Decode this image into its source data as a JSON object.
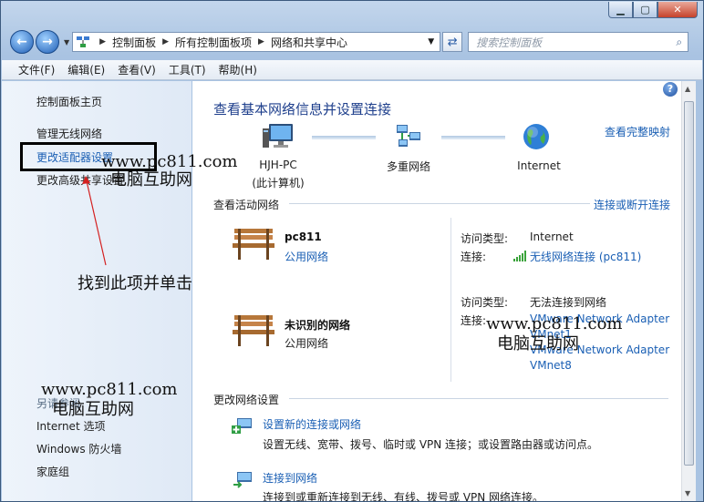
{
  "window": {
    "minimize_icon": "minimize-icon",
    "maximize_icon": "maximize-icon",
    "close_icon": "close-icon"
  },
  "address": {
    "crumbs": [
      "控制面板",
      "所有控制面板项",
      "网络和共享中心"
    ],
    "search_placeholder": "搜索控制面板"
  },
  "menu": [
    "文件(F)",
    "编辑(E)",
    "查看(V)",
    "工具(T)",
    "帮助(H)"
  ],
  "sidebar": {
    "items": [
      "控制面板主页",
      "管理无线网络",
      "更改适配器设置",
      "更改高级共享设置"
    ],
    "see_also_label": "另请参阅",
    "see_also_items": [
      "Internet 选项",
      "Windows 防火墙",
      "家庭组"
    ]
  },
  "content": {
    "title": "查看基本网络信息并设置连接",
    "full_map_link": "查看完整映射",
    "map": {
      "computer_label": "HJH-PC",
      "computer_sub": "(此计算机)",
      "middle_label": "多重网络",
      "internet_label": "Internet"
    },
    "active_networks_label": "查看活动网络",
    "connect_disconnect_link": "连接或断开连接",
    "networks": [
      {
        "name": "pc811",
        "type": "公用网络",
        "access_type_label": "访问类型:",
        "access_type_value": "Internet",
        "connection_label": "连接:",
        "connection_value": "无线网络连接 (pc811)"
      },
      {
        "name": "未识别的网络",
        "type": "公用网络",
        "access_type_label": "访问类型:",
        "access_type_value": "无法连接到网络",
        "connection_label": "连接:",
        "connection_values": [
          "VMware Network Adapter",
          "VMnet1",
          "VMware Network Adapter",
          "VMnet8"
        ]
      }
    ],
    "change_settings_label": "更改网络设置",
    "tasks": [
      {
        "link": "设置新的连接或网络",
        "desc": "设置无线、宽带、拨号、临时或 VPN 连接；或设置路由器或访问点。"
      },
      {
        "link": "连接到网络",
        "desc": "连接到或重新连接到无线、有线、拨号或 VPN 网络连接。"
      }
    ]
  },
  "overlays": {
    "watermark_url": "www.pc811.com",
    "watermark_cn": "电脑互助网",
    "instruction": "找到此项并单击"
  },
  "colors": {
    "link": "#1a5fb4",
    "title": "#1e3f8c",
    "annotation_arrow": "#d42020"
  }
}
